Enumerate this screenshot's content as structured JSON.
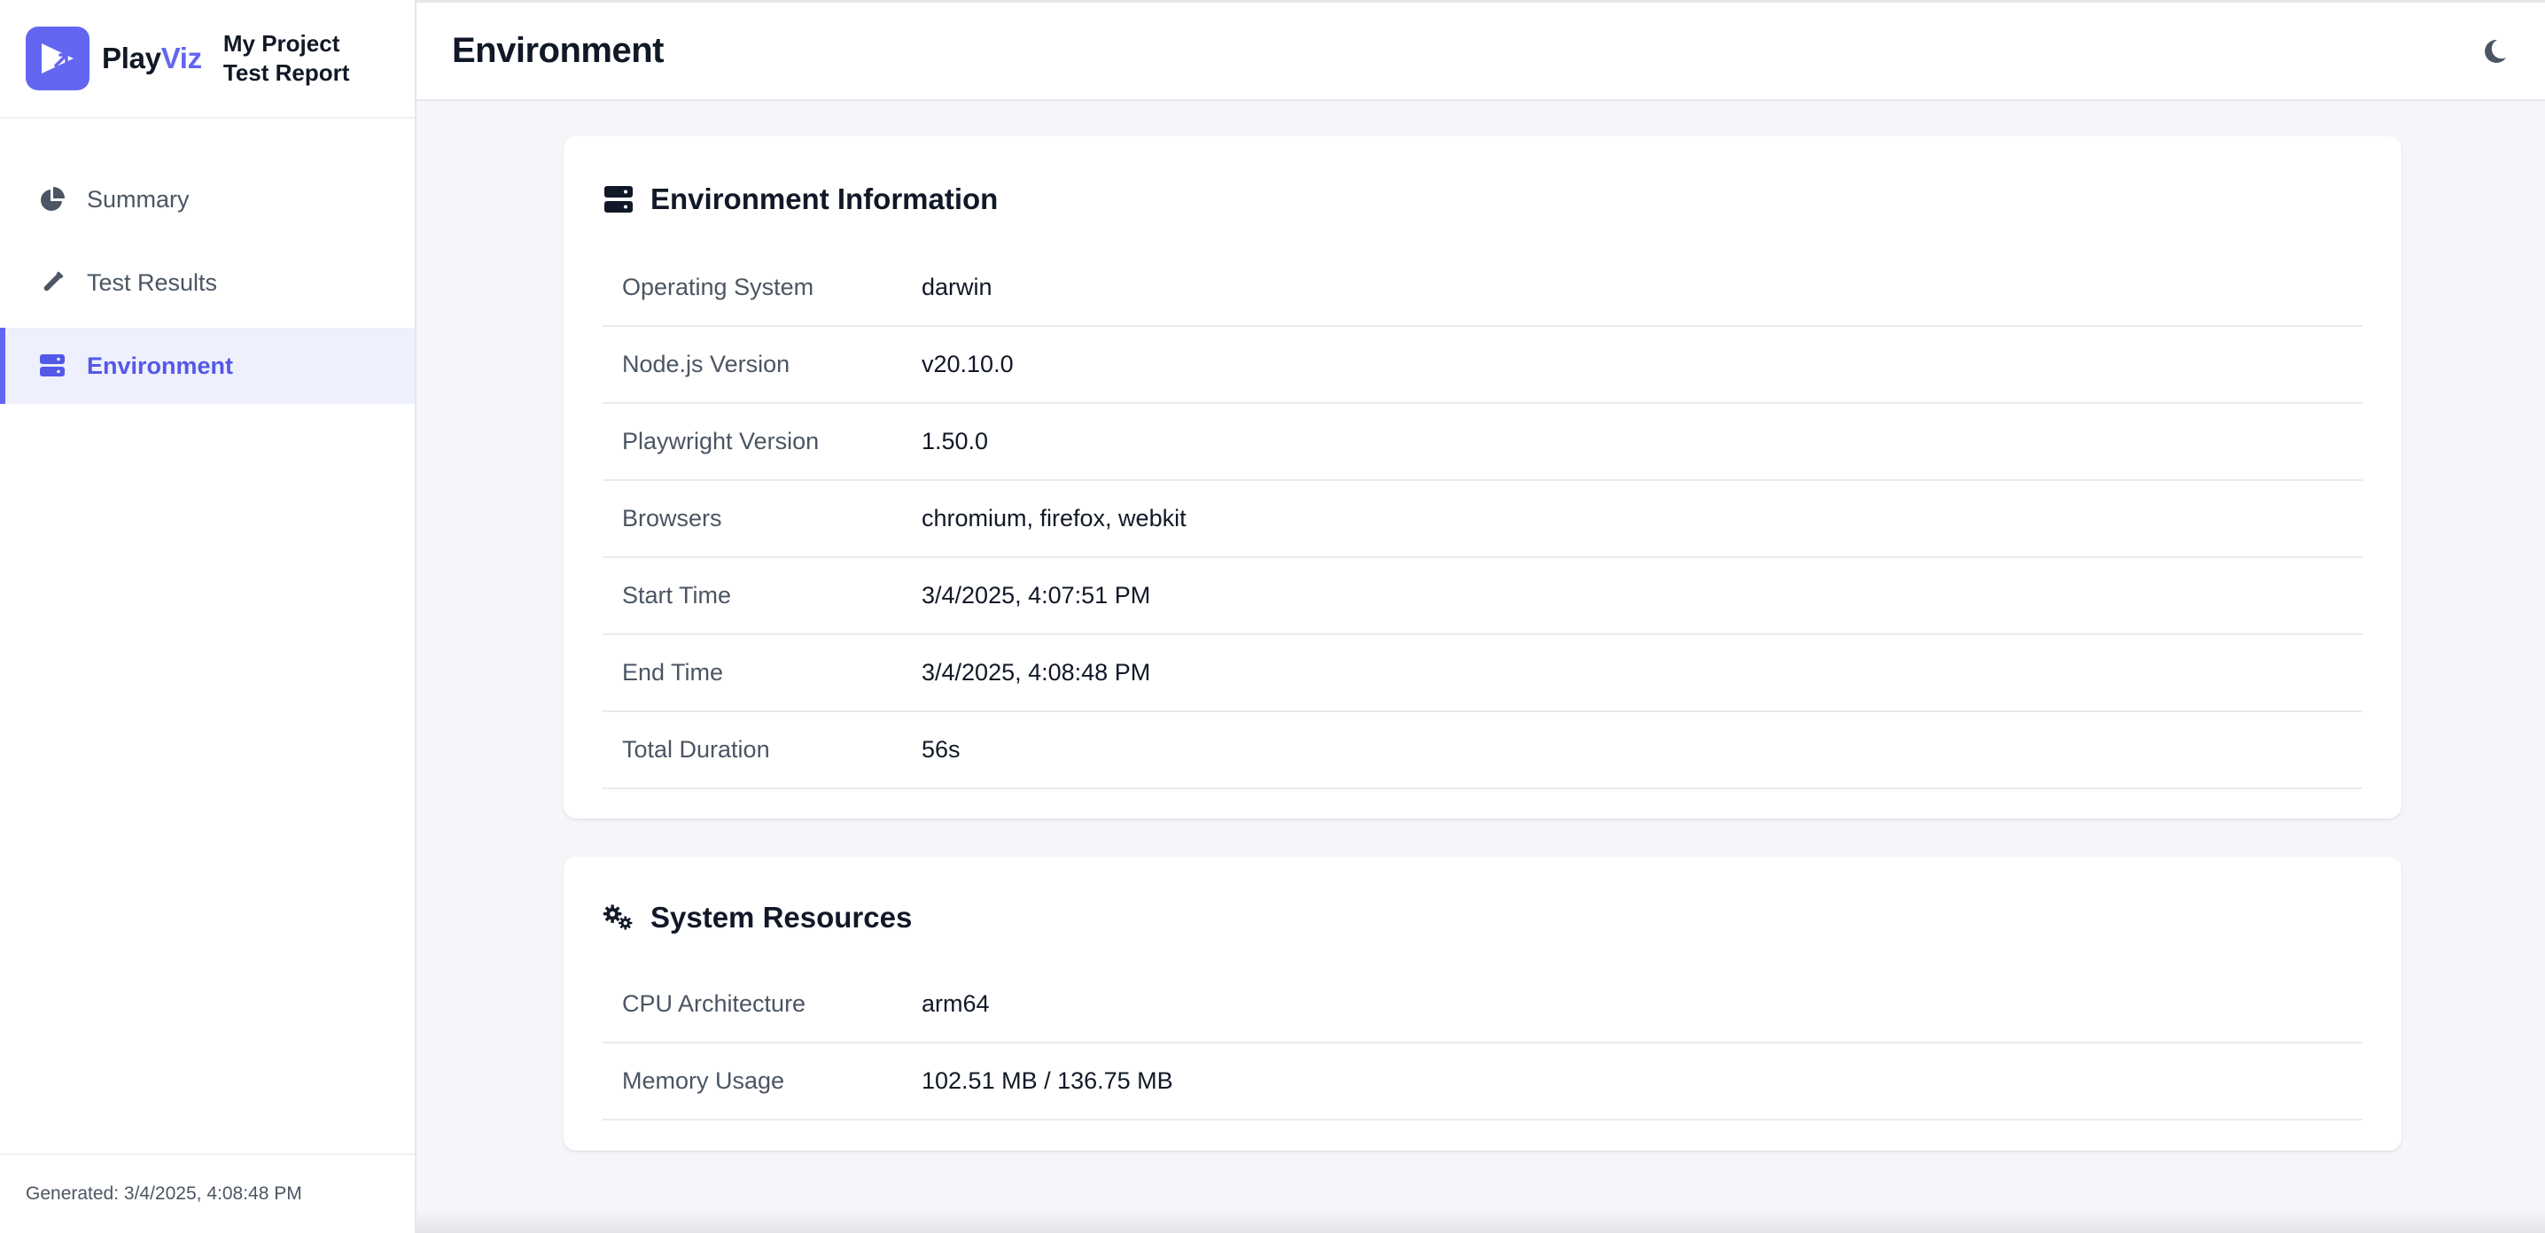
{
  "app": {
    "brand_play": "Play",
    "brand_viz": "Viz",
    "project_line1": "My Project",
    "project_line2": "Test Report",
    "accent_color": "#6366f1"
  },
  "sidebar": {
    "items": [
      {
        "label": "Summary",
        "icon": "pie-chart-icon",
        "active": false
      },
      {
        "label": "Test Results",
        "icon": "flask-icon",
        "active": false
      },
      {
        "label": "Environment",
        "icon": "server-icon",
        "active": true
      }
    ],
    "footer": "Generated: 3/4/2025, 4:08:48 PM"
  },
  "header": {
    "title": "Environment",
    "theme_toggle_icon": "moon-icon"
  },
  "environment_card": {
    "title": "Environment Information",
    "icon": "server-icon",
    "rows": [
      {
        "label": "Operating System",
        "value": "darwin"
      },
      {
        "label": "Node.js Version",
        "value": "v20.10.0"
      },
      {
        "label": "Playwright Version",
        "value": "1.50.0"
      },
      {
        "label": "Browsers",
        "value": "chromium, firefox, webkit"
      },
      {
        "label": "Start Time",
        "value": "3/4/2025, 4:07:51 PM"
      },
      {
        "label": "End Time",
        "value": "3/4/2025, 4:08:48 PM"
      },
      {
        "label": "Total Duration",
        "value": "56s"
      }
    ]
  },
  "resources_card": {
    "title": "System Resources",
    "icon": "cogs-icon",
    "rows": [
      {
        "label": "CPU Architecture",
        "value": "arm64"
      },
      {
        "label": "Memory Usage",
        "value": "102.51 MB / 136.75 MB"
      }
    ]
  }
}
